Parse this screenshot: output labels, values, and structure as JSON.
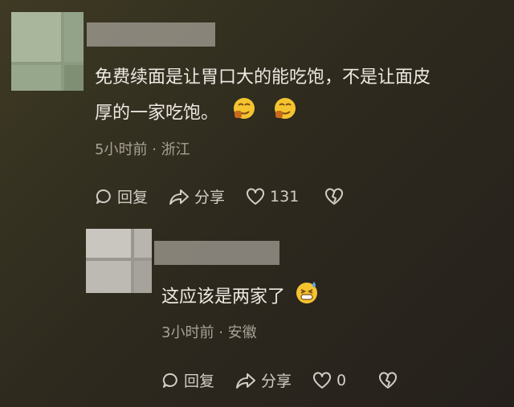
{
  "comments": [
    {
      "text_line1": "免费续面是让胃口大的能吃饱，不是让面皮",
      "text_line2": "厚的一家吃饱。",
      "emojis": [
        "drooling-face-icon",
        "drooling-face-icon"
      ],
      "time": "5小时前",
      "location": "浙江",
      "reply_label": "回复",
      "share_label": "分享",
      "like_count": "131"
    },
    {
      "text_line1": "这应该是两家了",
      "emojis": [
        "grimacing-sweat-face-icon"
      ],
      "time": "3小时前",
      "location": "安徽",
      "reply_label": "回复",
      "share_label": "分享",
      "like_count": "0"
    }
  ],
  "colors": {
    "text": "#efe9e2",
    "meta": "#a7a196",
    "action": "#d3cec6",
    "emoji": "#f4c430"
  }
}
